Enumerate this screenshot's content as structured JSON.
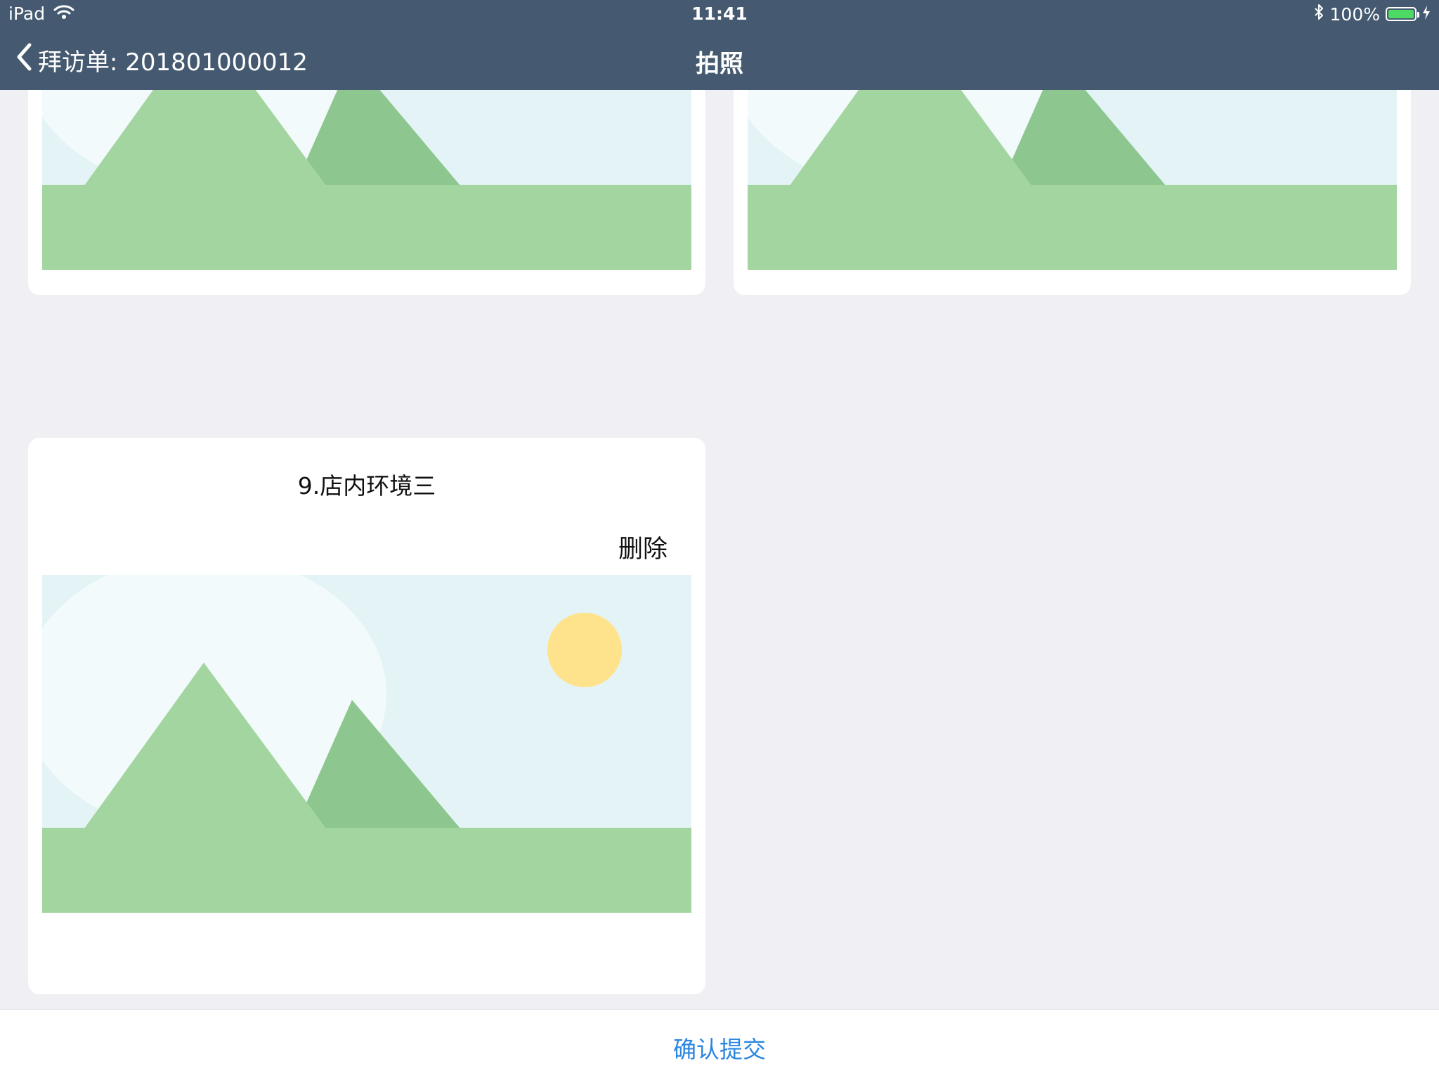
{
  "status_bar": {
    "device": "iPad",
    "time": "11:41",
    "battery_percent": "100%",
    "battery_level": 1.0,
    "icons": [
      "wifi-icon",
      "bluetooth-icon",
      "battery-icon",
      "charging-icon"
    ]
  },
  "nav": {
    "back_label": "拜访单: 201801000012",
    "title": "拍照",
    "back_icon": "chevron-left-icon"
  },
  "cards": [
    {
      "title": "",
      "delete_label": "",
      "image": "placeholder-landscape"
    },
    {
      "title": "",
      "delete_label": "",
      "image": "placeholder-landscape"
    },
    {
      "title": "9.店内环境三",
      "delete_label": "删除",
      "image": "placeholder-landscape"
    }
  ],
  "footer": {
    "submit_label": "确认提交"
  },
  "colors": {
    "nav_background": "#455a70",
    "page_background": "#efeff4",
    "accent": "#2a86e0",
    "battery_green": "#4cd964",
    "landscape_sky": "#e4f4f6",
    "landscape_ground": "#a3d5a0",
    "landscape_hill_dark": "#8dc68e",
    "landscape_sun": "#ffe28c"
  }
}
